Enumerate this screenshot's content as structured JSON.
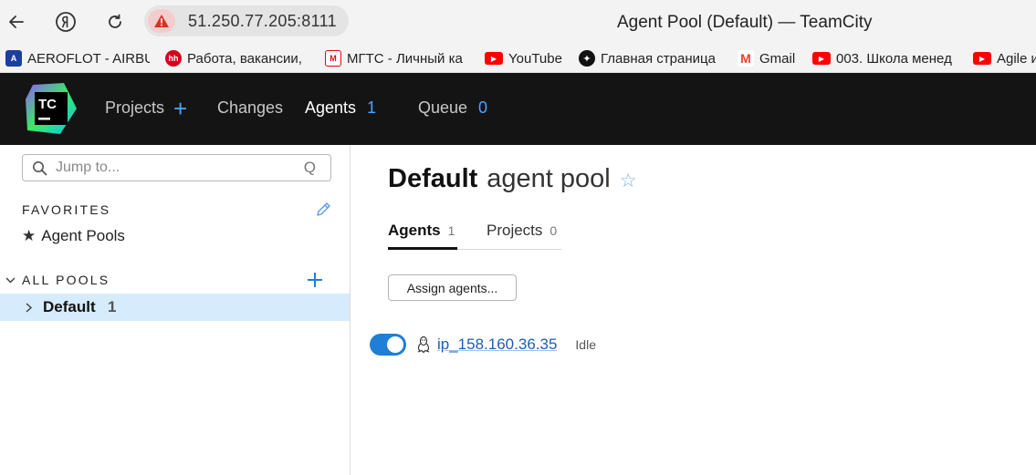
{
  "browser": {
    "back_icon": "back-arrow-icon",
    "yandex_icon": "yandex-icon",
    "reload_icon": "reload-icon",
    "address": "51.250.77.205:8111",
    "tab_title": "Agent Pool (Default) — TeamCity",
    "bookmarks": [
      {
        "label": "AEROFLOT - AIRBU",
        "icon_color": "#1b3fa0",
        "icon_text": "A"
      },
      {
        "label": "Работа, вакансии,",
        "icon_color": "#d6001c",
        "icon_text": "hh"
      },
      {
        "label": "МГТС - Личный ка",
        "icon_color": "#e30611",
        "icon_text": "M"
      },
      {
        "label": "YouTube",
        "icon_color": "#ff0000",
        "icon_text": "▶"
      },
      {
        "label": "Главная страница",
        "icon_color": "#111111",
        "icon_text": "✦"
      },
      {
        "label": "Gmail",
        "icon_color": "#ea4335",
        "icon_text": "M"
      },
      {
        "label": "003. Школа менед",
        "icon_color": "#ff0000",
        "icon_text": "▶"
      },
      {
        "label": "Agile и",
        "icon_color": "#ff0000",
        "icon_text": "▶"
      }
    ]
  },
  "header": {
    "logo_text": "TC",
    "nav": [
      {
        "label": "Projects",
        "count": "+"
      },
      {
        "label": "Changes",
        "count": ""
      },
      {
        "label": "Agents",
        "count": "1"
      },
      {
        "label": "Queue",
        "count": "0"
      }
    ]
  },
  "sidebar": {
    "search_placeholder": "Jump to...",
    "search_shortcut": "Q",
    "favorites_title": "FAVORITES",
    "favorites": [
      {
        "label": "Agent Pools"
      }
    ],
    "all_pools_title": "ALL POOLS",
    "pools": [
      {
        "name": "Default",
        "count": "1"
      }
    ]
  },
  "main": {
    "title_bold": "Default",
    "title_light": "agent pool",
    "tabs": [
      {
        "label": "Agents",
        "count": "1"
      },
      {
        "label": "Projects",
        "count": "0"
      }
    ],
    "assign_button": "Assign agents...",
    "agents": [
      {
        "name": "ip_158.160.36.35",
        "status": "Idle",
        "enabled": true
      }
    ]
  },
  "colors": {
    "accent": "#4aa3ff",
    "header_bg": "#141414",
    "selected_row": "#d6ebfb",
    "link": "#1761b5",
    "toggle_on": "#1f7fd6"
  }
}
